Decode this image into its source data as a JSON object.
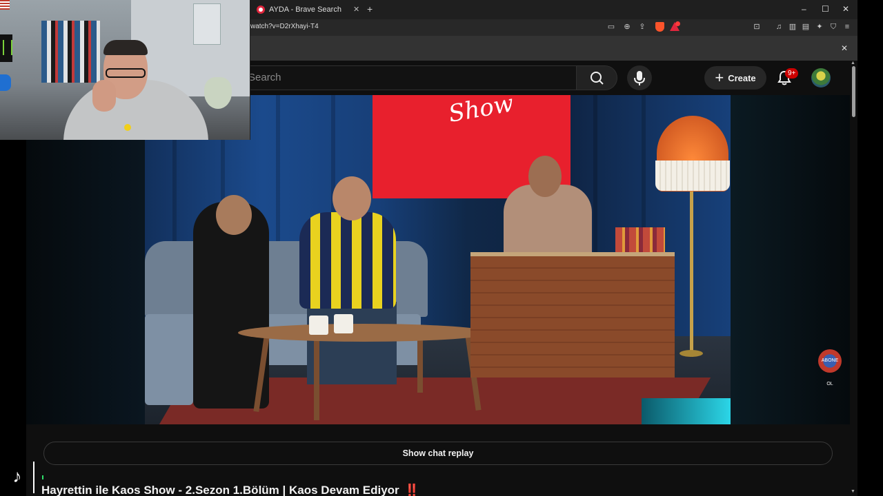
{
  "browser": {
    "tab_title": "AYDA - Brave Search",
    "url": "watch?v=D2rXhayi-T4",
    "window_controls": {
      "minimize": "–",
      "maximize": "☐",
      "close": "✕"
    },
    "infobar_close": "✕"
  },
  "youtube": {
    "search_placeholder": "Search",
    "create_label": "Create",
    "notification_badge": "9+",
    "show_chat_replay": "Show chat replay",
    "video_title": "Hayrettin ile Kaos Show - 2.Sezon 1.Bölüm | Kaos Devam Ediyor",
    "title_emoji": "‼️"
  },
  "video": {
    "screen_logo": "Show",
    "watermark": "ABONE OL"
  },
  "colors": {
    "youtube_bg": "#0f0f0f",
    "notification_red": "#cc0000",
    "brave_orange": "#fb542b"
  },
  "icons": {
    "tiktok": "tiktok-logo-icon",
    "search": "search-icon",
    "mic": "microphone-icon",
    "bell": "bell-icon"
  }
}
